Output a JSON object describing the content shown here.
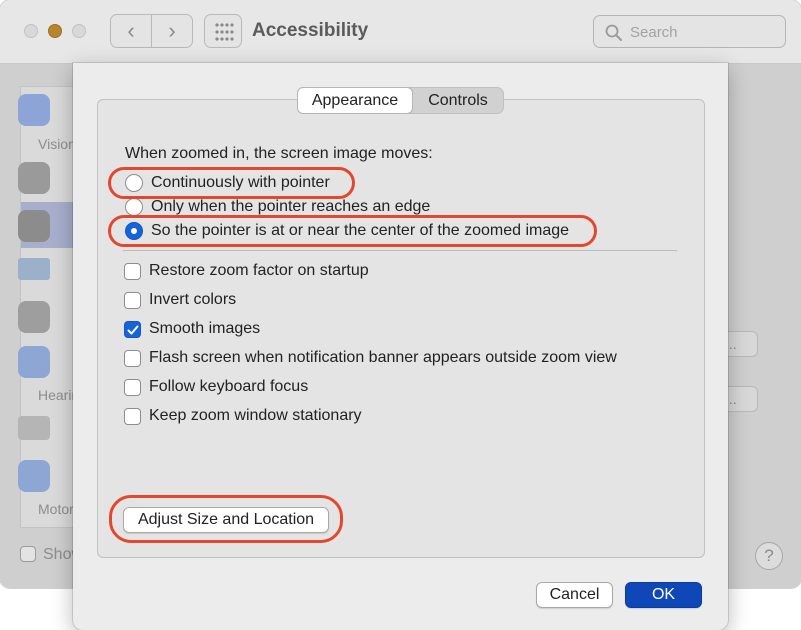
{
  "window": {
    "title": "Accessibility",
    "search_placeholder": "Search",
    "sidebar": {
      "labels": [
        "Vision",
        "Hearing",
        "Motor"
      ]
    },
    "background_buttons": [
      "...",
      "..."
    ],
    "show_label": "Show",
    "help_label": "?"
  },
  "dialog": {
    "tabs": [
      "Appearance",
      "Controls"
    ],
    "active_tab": "Appearance",
    "movement_prompt": "When zoomed in, the screen image moves:",
    "movement_options": [
      {
        "label": "Continuously with pointer",
        "selected": false
      },
      {
        "label": "Only when the pointer reaches an edge",
        "selected": false
      },
      {
        "label": "So the pointer is at or near the center of the zoomed image",
        "selected": true
      }
    ],
    "checkboxes": [
      {
        "label": "Restore zoom factor on startup",
        "checked": false
      },
      {
        "label": "Invert colors",
        "checked": false
      },
      {
        "label": "Smooth images",
        "checked": true
      },
      {
        "label": "Flash screen when notification banner appears outside zoom view",
        "checked": false
      },
      {
        "label": "Follow keyboard focus",
        "checked": false
      },
      {
        "label": "Keep zoom window stationary",
        "checked": false
      }
    ],
    "adjust_button": "Adjust Size and Location",
    "cancel_button": "Cancel",
    "ok_button": "OK"
  },
  "colors": {
    "accent": "#1764d9",
    "default_button": "#0f47b8",
    "annotation": "#e2482d"
  }
}
